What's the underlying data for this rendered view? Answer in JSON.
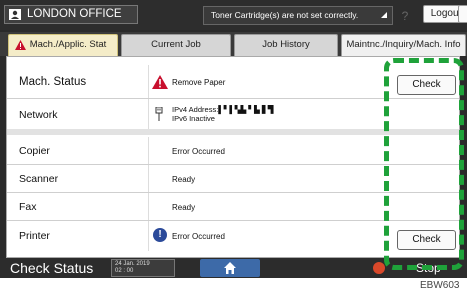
{
  "topbar": {
    "office_name": "LONDON OFFICE",
    "toner_message": "Toner Cartridge(s) are not set correctly.",
    "help_label": "?",
    "logout_label": "Logout"
  },
  "tabs": [
    {
      "label": "Mach./Applic. Stat"
    },
    {
      "label": "Current Job"
    },
    {
      "label": "Job History"
    },
    {
      "label": "Maintnc./Inquiry/Mach. Info"
    }
  ],
  "status_rows": {
    "machine": {
      "label": "Mach. Status",
      "value": "Remove Paper",
      "button": "Check"
    },
    "network": {
      "label": "Network",
      "ipv4": "IPv4 Address:▌▘▌▚▙  ▘▙ ▋▜",
      "ipv6": "IPv6 Inactive"
    },
    "copier": {
      "label": "Copier",
      "value": "Error Occurred"
    },
    "scanner": {
      "label": "Scanner",
      "value": "Ready"
    },
    "fax": {
      "label": "Fax",
      "value": "Ready"
    },
    "printer": {
      "label": "Printer",
      "value": "Error Occurred",
      "button": "Check"
    }
  },
  "bottombar": {
    "check_status": "Check Status",
    "date": "24 Jan. 2019",
    "time": "02 : 00",
    "stop_label": "Stop"
  },
  "figure_code": "EBW603",
  "colors": {
    "highlight": "#1fa23a",
    "warning_red": "#c8102e",
    "info_blue": "#2b4a9a",
    "home_blue": "#3d6aa8"
  }
}
